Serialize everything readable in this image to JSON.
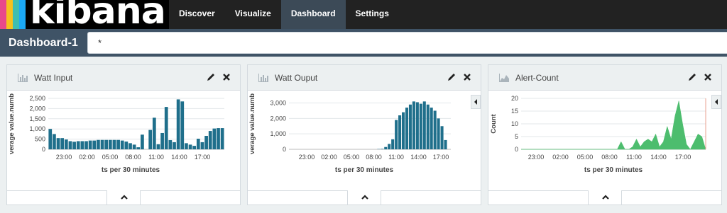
{
  "brand": {
    "name": "kibana",
    "stripe_colors": [
      "#e8488b",
      "#f5c11d",
      "#3ebeb0",
      "#1ba9f5"
    ]
  },
  "nav": {
    "items": [
      "Discover",
      "Visualize",
      "Dashboard",
      "Settings"
    ],
    "active": "Dashboard"
  },
  "dashboard": {
    "title": "Dashboard-1",
    "query_value": "*"
  },
  "panels": [
    {
      "title": "Watt Input",
      "y_label": "verage value.numb",
      "x_label": "ts per 30 minutes"
    },
    {
      "title": "Watt Ouput",
      "y_label": "verage value.numb",
      "x_label": "ts per 30 minutes"
    },
    {
      "title": "Alert-Count",
      "y_label": "Count",
      "x_label": "ts per 30 minutes"
    }
  ],
  "chart_data": [
    {
      "type": "bar",
      "color": "#1f6f8b",
      "ylim": [
        0,
        2500
      ],
      "yticks": [
        "0",
        "500",
        "1,000",
        "1,500",
        "2,000",
        "2,500"
      ],
      "xticks": [
        "23:00",
        "02:00",
        "05:00",
        "08:00",
        "11:00",
        "14:00",
        "17:00"
      ],
      "values": [
        1000,
        750,
        550,
        550,
        480,
        400,
        370,
        400,
        400,
        400,
        430,
        430,
        460,
        460,
        460,
        460,
        460,
        460,
        430,
        380,
        300,
        230,
        100,
        720,
        0,
        950,
        1550,
        250,
        800,
        2080,
        450,
        350,
        2450,
        2350,
        300,
        230,
        170,
        520,
        350,
        660,
        900,
        1020,
        1040,
        1040
      ]
    },
    {
      "type": "bar",
      "color": "#1f6f8b",
      "ylim": [
        0,
        3300
      ],
      "yticks": [
        "0",
        "1,000",
        "2,000",
        "3,000"
      ],
      "xticks": [
        "23:00",
        "02:00",
        "05:00",
        "08:00",
        "11:00",
        "14:00",
        "17:00"
      ],
      "values": [
        0,
        0,
        0,
        0,
        0,
        0,
        0,
        0,
        0,
        0,
        0,
        0,
        0,
        0,
        0,
        0,
        0,
        0,
        0,
        0,
        0,
        0,
        0,
        0,
        0,
        20,
        30,
        150,
        350,
        650,
        1900,
        2200,
        2400,
        2700,
        2900,
        3100,
        3050,
        2950,
        3100,
        2900,
        2700,
        2500,
        2000,
        1500,
        600,
        0
      ]
    },
    {
      "type": "area",
      "color": "#4dbd6e",
      "ylim": [
        0,
        20
      ],
      "yticks": [
        "0",
        "5",
        "10",
        "15",
        "20"
      ],
      "xticks": [
        "23:00",
        "02:00",
        "05:00",
        "08:00",
        "11:00",
        "14:00",
        "17:00"
      ],
      "values": [
        0,
        0,
        0,
        0,
        0,
        0,
        0,
        0,
        0,
        0,
        0,
        0,
        0,
        0,
        0,
        0,
        0,
        0,
        0,
        0,
        0,
        0,
        0,
        0,
        0,
        0,
        3,
        0,
        0,
        1,
        4,
        1,
        3,
        4,
        3,
        6,
        1,
        3,
        9,
        4,
        13,
        19,
        10,
        2,
        0,
        3,
        6,
        5,
        0
      ]
    }
  ]
}
